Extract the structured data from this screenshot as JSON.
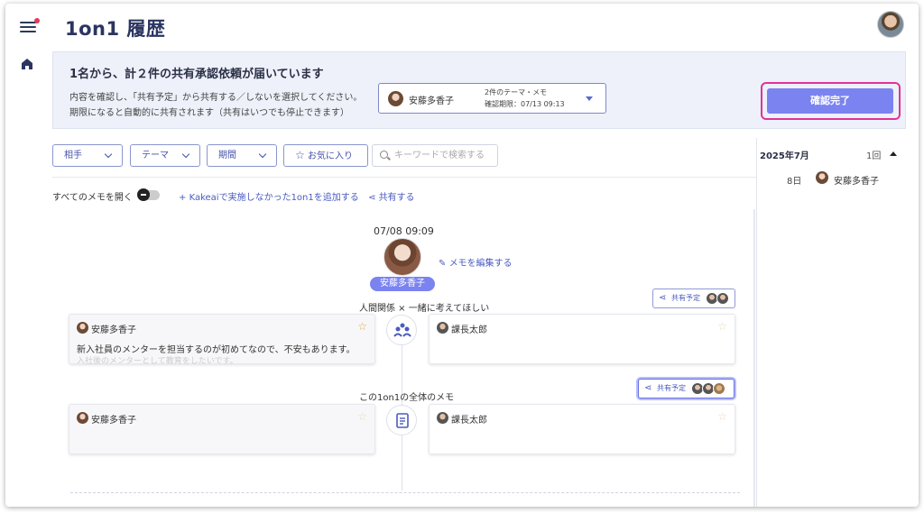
{
  "header": {
    "title": "1on1 履歴"
  },
  "notice": {
    "title": "1名から、計２件の共有承認依頼が届いています",
    "desc_line1": "内容を確認し、「共有予定」から共有する／しないを選択してください。",
    "desc_line2": "期限になると自動的に共有されます（共有はいつでも停止できます）",
    "request": {
      "name": "安藤多香子",
      "meta_line1": "2件のテーマ・メモ",
      "meta_line2": "確認期限：07/13 09:13"
    },
    "confirm_label": "確認完了"
  },
  "filters": {
    "partner": "相手",
    "theme": "テーマ",
    "period": "期間",
    "favorites": "お気に入り",
    "search_placeholder": "キーワードで検索する"
  },
  "actions": {
    "open_all": "すべてのメモを開く",
    "add_external": "Kakeaiで実施しなかった1on1を追加する",
    "share": "共有する"
  },
  "side": {
    "month": "2025年7月",
    "count": "1回",
    "entries": [
      {
        "day": "8日",
        "name": "安藤多香子"
      }
    ]
  },
  "session": {
    "datetime": "07/08 09:09",
    "edit_memo": "メモを編集する",
    "member_name": "安藤多香子",
    "topics": [
      {
        "label": "人間関係 × 一緒に考えてほしい",
        "share_label": "共有予定",
        "left_name": "安藤多香子",
        "left_body": "新入社員のメンターを担当するのが初めてなので、不安もあります。",
        "left_fade": "入社後のメンターとして教育をしたいです。",
        "right_name": "課長太郎"
      },
      {
        "label": "この1on1の全体のメモ",
        "share_label": "共有予定",
        "left_name": "安藤多香子",
        "right_name": "課長太郎"
      }
    ]
  },
  "colors": {
    "accent": "#7b83f0",
    "highlight": "#e0339a",
    "title": "#2a3560"
  }
}
